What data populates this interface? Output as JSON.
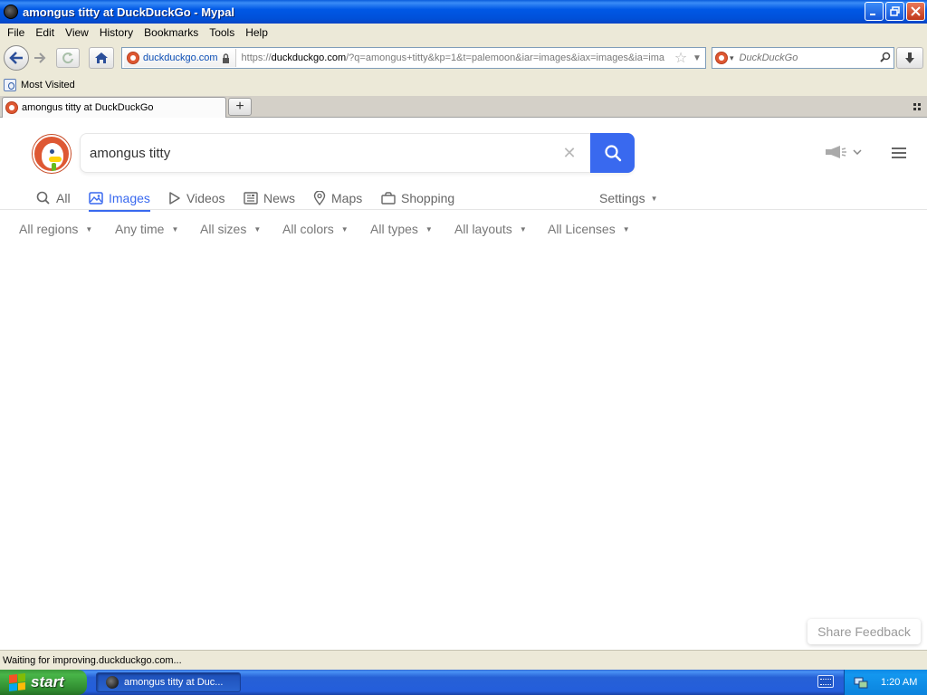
{
  "window": {
    "title": "amongus titty at DuckDuckGo - Mypal",
    "buttons": {
      "minimize": "_",
      "maximize": "❐",
      "close": "✕"
    }
  },
  "menubar": {
    "items": [
      "File",
      "Edit",
      "View",
      "History",
      "Bookmarks",
      "Tools",
      "Help"
    ]
  },
  "navbar": {
    "identity_label": "duckduckgo.com",
    "url_prefix": "https://",
    "url_host": "duckduckgo.com",
    "url_rest": "/?q=amongus+titty&kp=1&t=palemoon&iar=images&iax=images&ia=ima",
    "search_engine_placeholder": "DuckDuckGo"
  },
  "bookmarks": {
    "most_visited": "Most Visited"
  },
  "tabs": {
    "active_title": "amongus titty at DuckDuckGo",
    "new_tab": "+"
  },
  "page": {
    "search": {
      "query": "amongus titty",
      "clear": "✕"
    },
    "nav_tabs": [
      "All",
      "Images",
      "Videos",
      "News",
      "Maps",
      "Shopping"
    ],
    "active_tab": "Images",
    "settings": "Settings",
    "filters": [
      "All regions",
      "Any time",
      "All sizes",
      "All colors",
      "All types",
      "All layouts",
      "All Licenses"
    ],
    "feedback": "Share Feedback",
    "accent": "#3969ef"
  },
  "statusbar": {
    "text": "Waiting for improving.duckduckgo.com..."
  },
  "taskbar": {
    "start": "start",
    "task_item": "amongus titty at Duc...",
    "clock": "1:20 AM"
  }
}
